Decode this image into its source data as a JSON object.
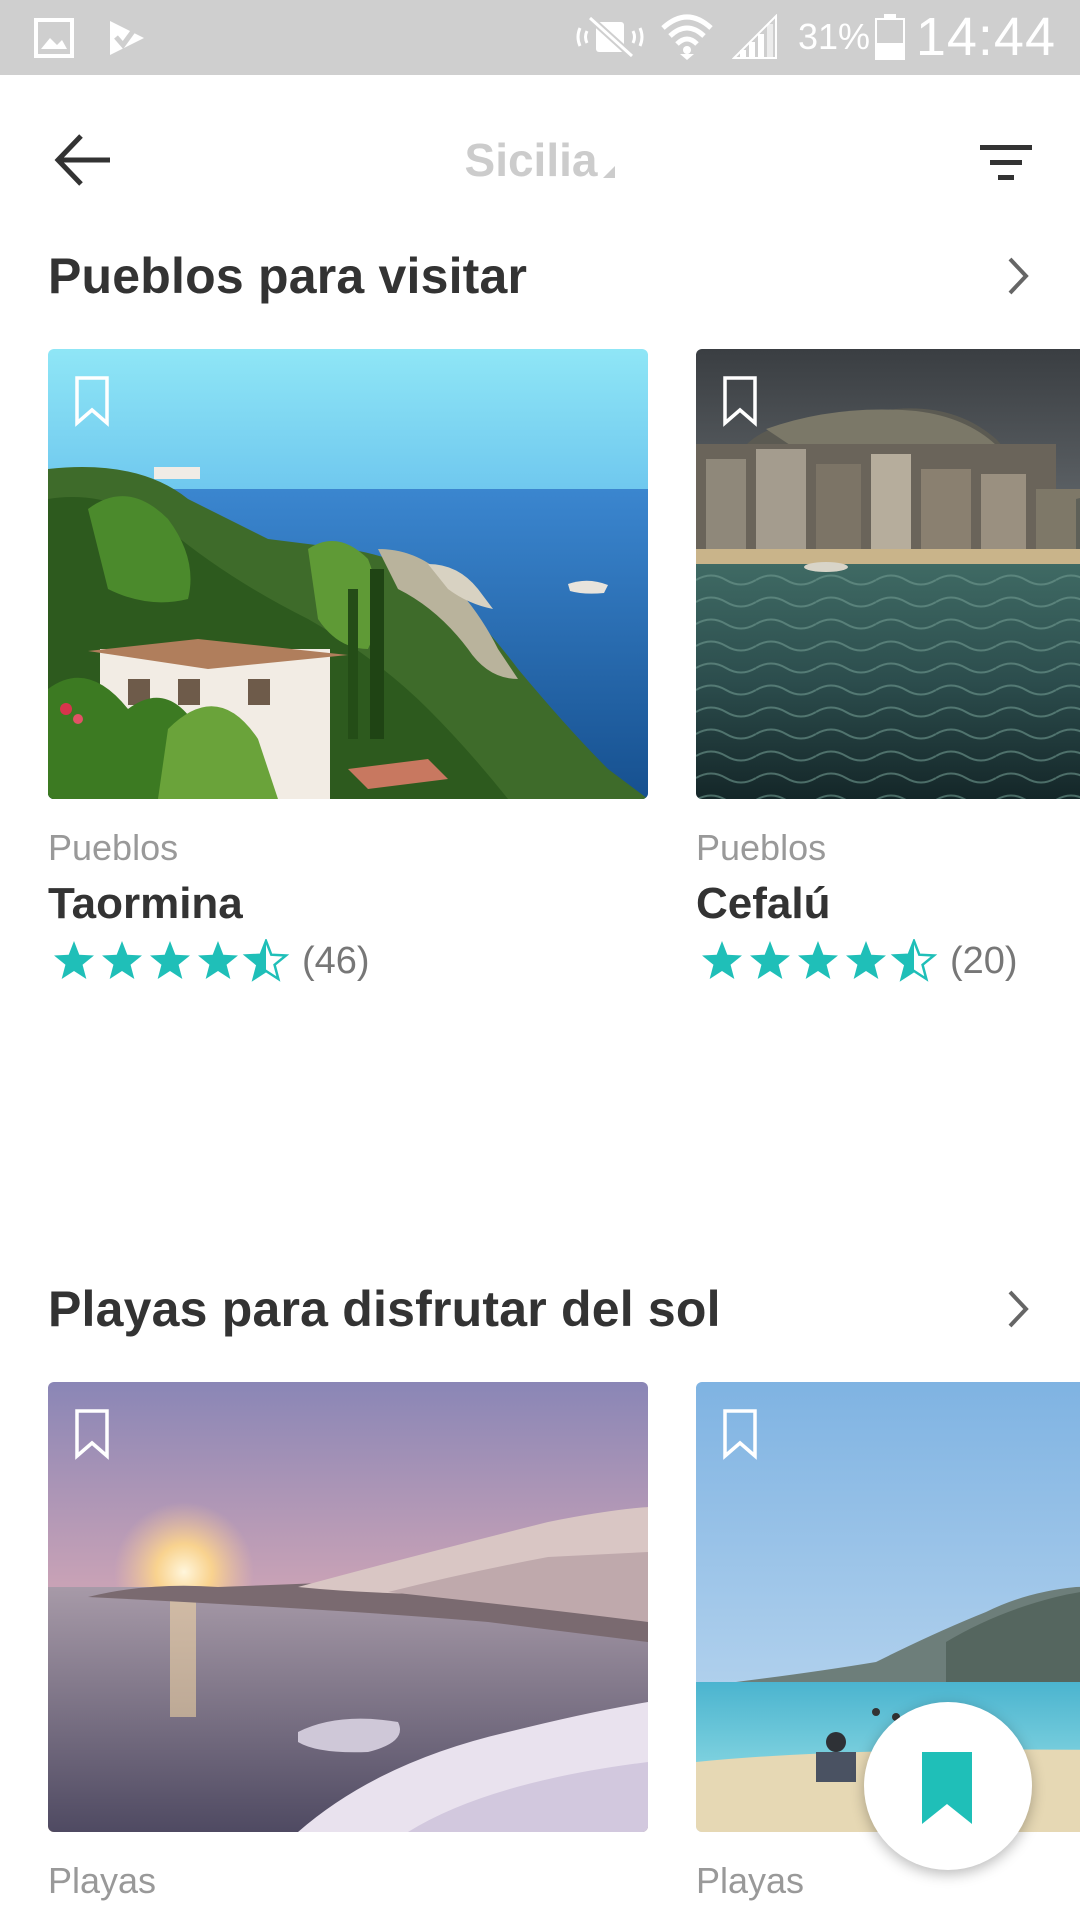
{
  "status_bar": {
    "battery": "31%",
    "time": "14:44",
    "icons": [
      "gallery-icon",
      "check-icon",
      "mute-icon",
      "wifi-icon",
      "signal-icon",
      "battery-icon"
    ]
  },
  "app_bar": {
    "title": "Sicilia",
    "icons": [
      "back-arrow-icon",
      "filter-icon"
    ]
  },
  "sections": [
    {
      "title": "Pueblos para visitar",
      "cards": [
        {
          "category": "Pueblos",
          "name": "Taormina",
          "rating": 4.5,
          "reviews": "(46)"
        },
        {
          "category": "Pueblos",
          "name": "Cefalú",
          "rating": 4.5,
          "reviews": "(20)"
        }
      ]
    },
    {
      "title": "Playas para disfrutar del sol",
      "cards": [
        {
          "category": "Playas"
        },
        {
          "category": "Playas"
        }
      ]
    }
  ],
  "colors": {
    "accent": "#1fbfb8",
    "status_bar": "#cfcfcf",
    "title_muted": "#cccccc",
    "text_primary": "#333333",
    "text_secondary": "#999999"
  }
}
